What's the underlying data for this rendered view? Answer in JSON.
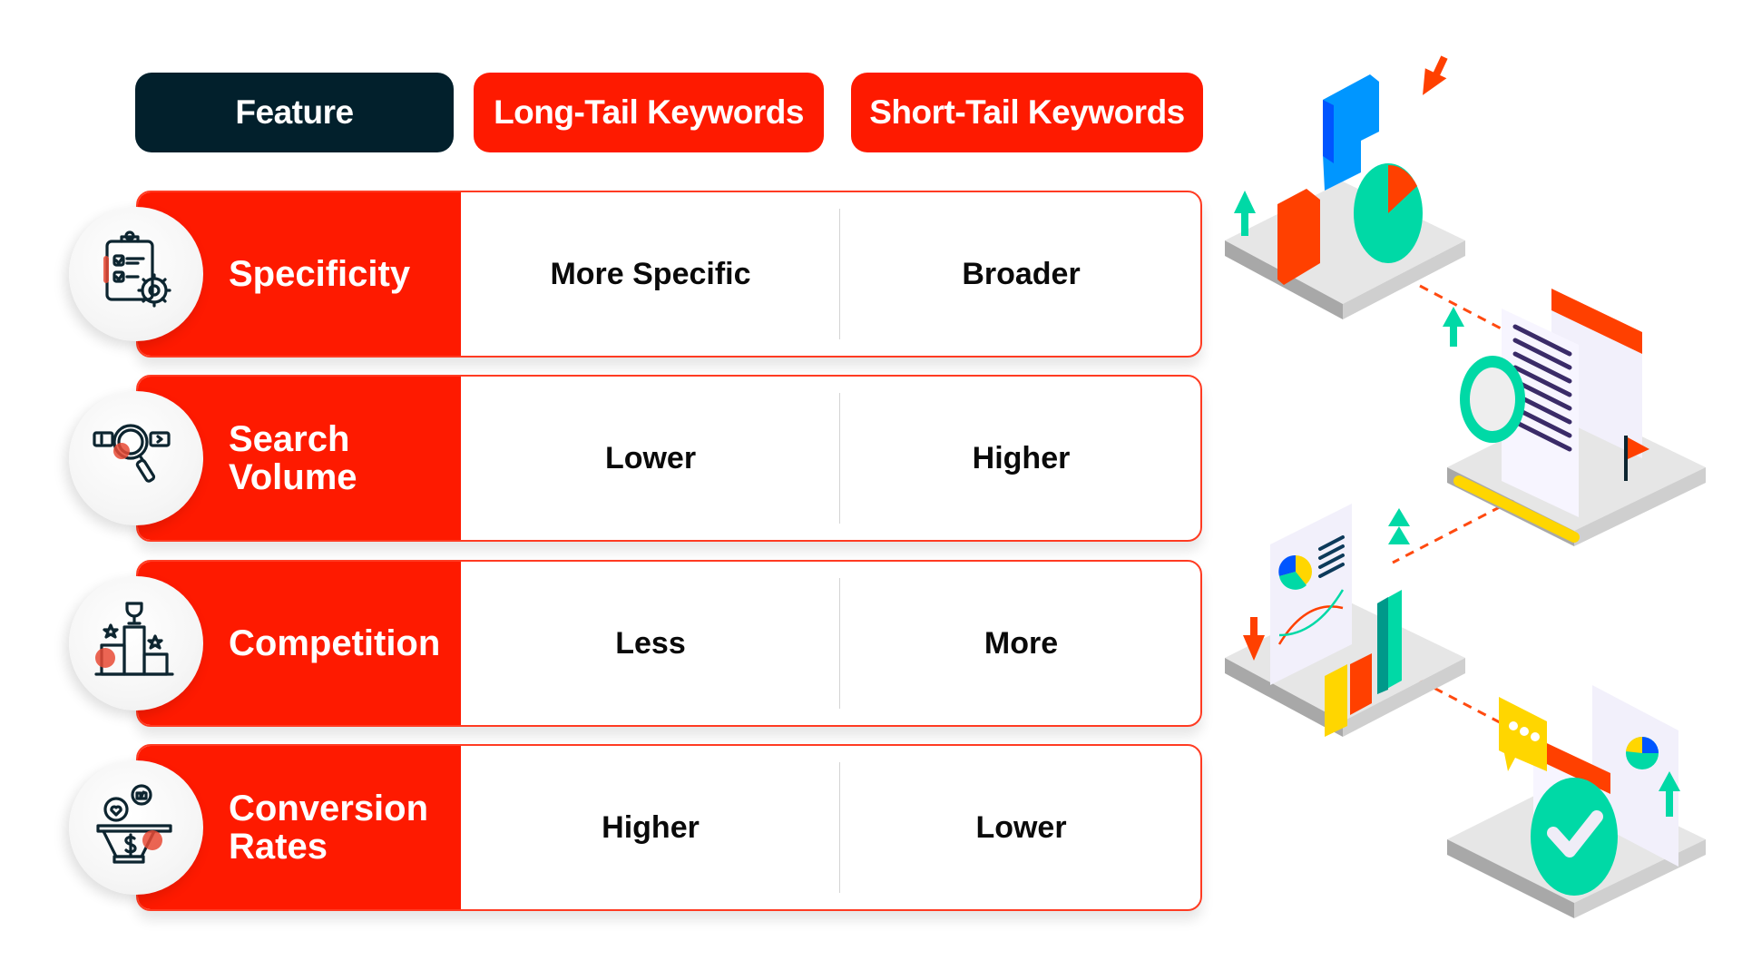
{
  "headers": {
    "feature": "Feature",
    "long_tail": "Long-Tail Keywords",
    "short_tail": "Short-Tail Keywords"
  },
  "rows": [
    {
      "feature": "Specificity",
      "icon": "clipboard-gear-icon",
      "long_tail": "More Specific",
      "short_tail": "Broader"
    },
    {
      "feature": "Search Volume",
      "icon": "search-magnifier-icon",
      "long_tail": "Lower",
      "short_tail": "Higher"
    },
    {
      "feature": "Competition",
      "icon": "trophy-podium-icon",
      "long_tail": "Less",
      "short_tail": "More"
    },
    {
      "feature": "Conversion Rates",
      "icon": "funnel-dollar-icon",
      "long_tail": "Higher",
      "short_tail": "Lower"
    }
  ],
  "colors": {
    "accent_red": "#fe1a00",
    "dark_navy": "#02202c",
    "teal": "#00d9a6",
    "blue": "#0096ff",
    "yellow": "#ffd600",
    "orange_red": "#ff4000"
  },
  "illustration": {
    "scenes": [
      "puzzle-pie-scene",
      "document-search-scene",
      "analytics-chart-scene",
      "approval-check-scene"
    ]
  }
}
